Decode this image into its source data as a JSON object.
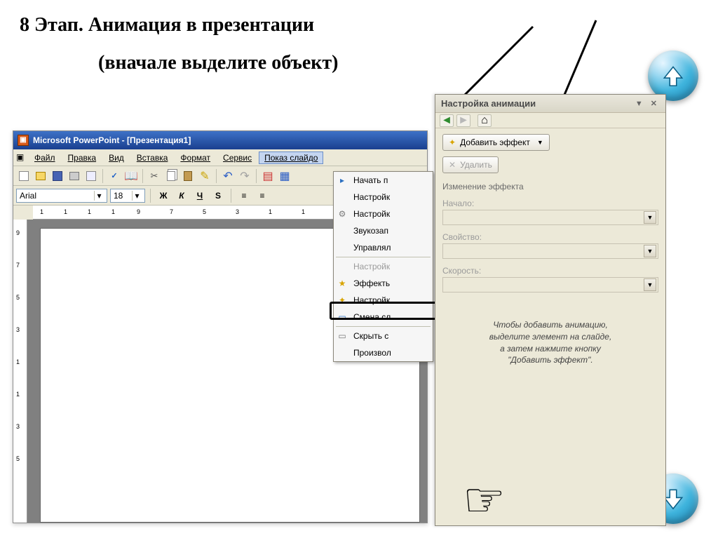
{
  "slide": {
    "title": "8 Этап. Анимация в презентации",
    "subtitle": "(вначале выделите объект)"
  },
  "hand": "☞",
  "pp": {
    "title": "Microsoft PowerPoint - [Презентация1]",
    "menu": {
      "file": "Файл",
      "edit": "Правка",
      "view": "Вид",
      "insert": "Вставка",
      "format": "Формат",
      "tools": "Сервис",
      "show": "Показ слайдо"
    },
    "font": "Arial",
    "fontSize": "18",
    "bold": "Ж",
    "italic": "К",
    "underline": "Ч",
    "shadow": "S"
  },
  "dropdown": {
    "items": [
      "Начать п",
      "Настройк",
      "Настройк",
      "Звукозап",
      "Управлял",
      "Настройк",
      "Эффекть",
      "Настройк",
      "Смена сл",
      "Скрыть с",
      "Произвол"
    ],
    "disabledIndex": 5
  },
  "anim": {
    "title": "Настройка анимации",
    "addEffect": "Добавить эффект",
    "delete": "Удалить",
    "change": "Изменение эффекта",
    "start": "Начало:",
    "property": "Свойство:",
    "speed": "Скорость:",
    "hint1": "Чтобы добавить анимацию,",
    "hint2": "выделите элемент на слайде,",
    "hint3": "а затем нажмите кнопку",
    "hint4": "\"Добавить эффект\"."
  }
}
